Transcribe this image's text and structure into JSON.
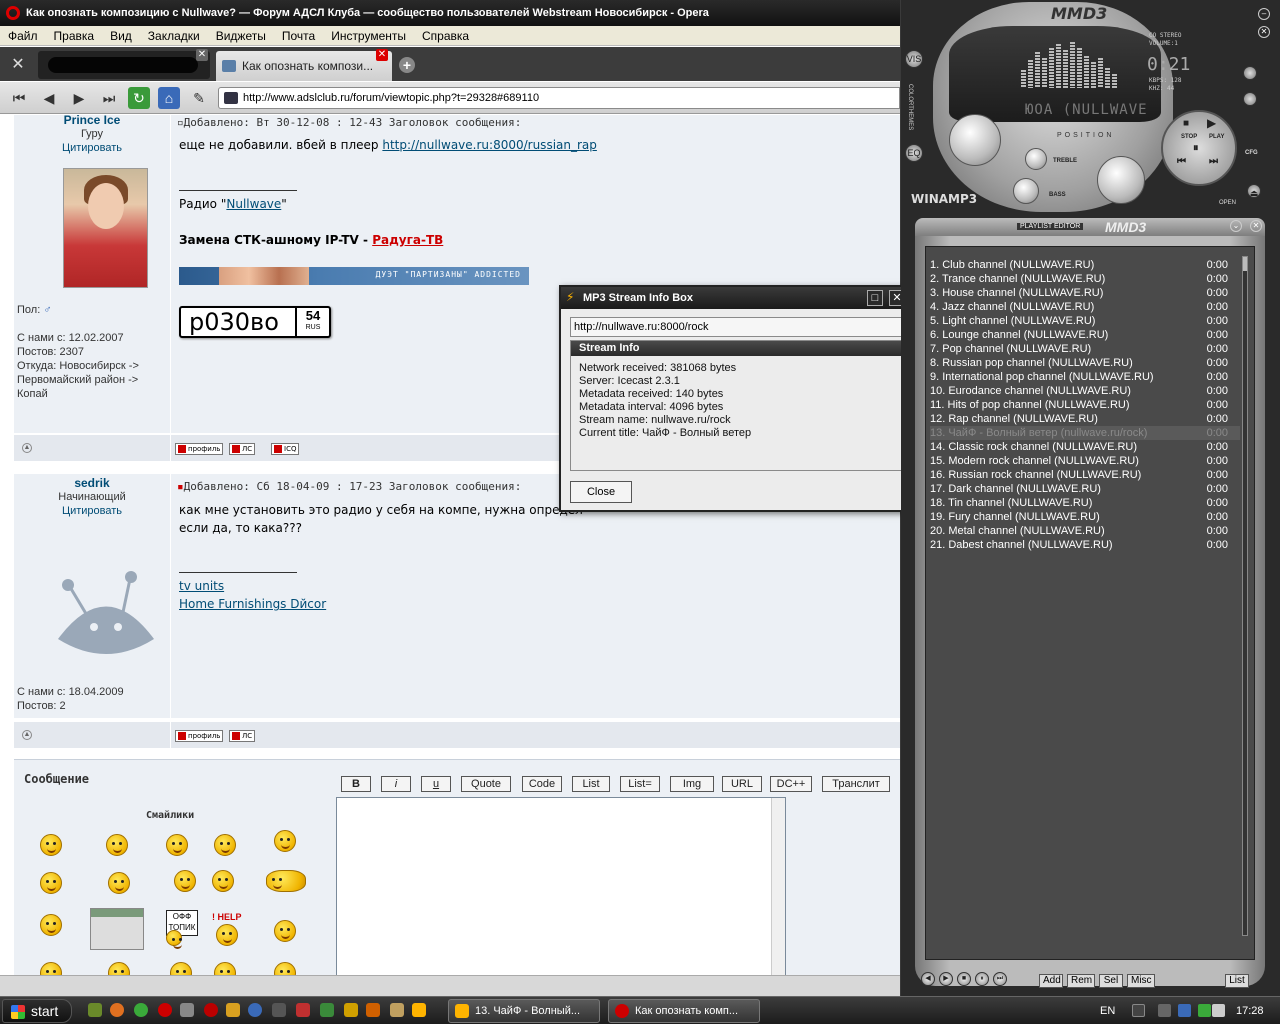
{
  "opera": {
    "title": "Как опознать композицию с Nullwave? — Форум АДСЛ Клуба — сообщество пользователей Webstream Новосибирск - Opera",
    "menu": [
      "Файл",
      "Правка",
      "Вид",
      "Закладки",
      "Виджеты",
      "Почта",
      "Инструменты",
      "Справка"
    ],
    "tab_title": "Как опознать компози...",
    "url": "http://www.adslclub.ru/forum/viewtopic.php?t=29328#689110",
    "icons": [
      "tools-icon",
      "rewind-icon",
      "back-icon",
      "forward-icon",
      "fast-forward-icon",
      "reload-icon",
      "home-icon",
      "wand-icon"
    ]
  },
  "post1": {
    "author": "Prince Ice",
    "rank": "Гуру",
    "quote": "Цитировать",
    "gender_label": "Пол:",
    "joined": "С нами с: 12.02.2007",
    "posts": "Постов: 2307",
    "from1": "Откуда: Новосибирск ->",
    "from2": "Первомайский район ->",
    "from3": "Копай",
    "header": "Добавлено: Вт 30-12-08 : 12-43    Заголовок сообщения:",
    "text": "еще не добавили. вбей в плеер",
    "link": "http://nullwave.ru:8000/russian_rap",
    "radio_prefix": "Радио \"",
    "radio_link": "Nullwave",
    "radio_suffix": "\"",
    "sig_text": "Замена СТК-ашному IP-TV - ",
    "sig_link": "Радуга-ТВ",
    "banner_text": "ДУЭТ \"ПАРТИЗАНЫ\" ADDICTED",
    "plate_number": "р030во",
    "plate_region": "54",
    "plate_rus": "RUS",
    "btn_profile": "профиль",
    "btn_pm": "ЛС",
    "btn_icq": "ICQ"
  },
  "post2": {
    "author": "sedrik",
    "rank": "Начинающий",
    "quote": "Цитировать",
    "joined": "С нами с: 18.04.2009",
    "posts": "Постов: 2",
    "header": "Добавлено: Сб 18-04-09 : 17-23    Заголовок сообщения:",
    "text1": "как мне установить это радио у себя на компе, нужна определ",
    "text2": "если да, то кака???",
    "link1": "tv units",
    "link2": "Home Furnishings Dйcor",
    "btn_profile": "профиль",
    "btn_pm": "ЛС"
  },
  "reply": {
    "title": "Сообщение",
    "smilies_title": "Смайлики",
    "buttons": [
      "B",
      "i",
      "u",
      "Quote",
      "Code",
      "List",
      "List=",
      "Img",
      "URL",
      "DC++",
      "Транслит"
    ],
    "sign_text": "ОФФ ТОПИК",
    "help_text": "! HELP"
  },
  "dialog": {
    "title": "MP3 Stream Info Box",
    "url": "http://nullwave.ru:8000/rock",
    "group_title": "Stream Info",
    "lines": [
      "Network received: 381068 bytes",
      "Server: Icecast 2.3.1",
      "Metadata received: 140 bytes",
      "Metadata interval: 4096 bytes",
      "Stream name: nullwave.ru/rock",
      "Current title: ЧайФ - Волный ветер"
    ],
    "close_label": "Close"
  },
  "player": {
    "logo": "MMD3",
    "time": "0:21",
    "stereo": "CO STEREO",
    "volume": "VOLUME:1",
    "kbps": "KBPS: 128",
    "khz": "KHZ: 44",
    "scroll_text": "ЮОА  (NULLWAVE",
    "position_label": "POSITION",
    "stop_label": "STOP",
    "play_label": "PLAY",
    "treble_label": "TREBLE",
    "bass_label": "BASS",
    "winamp_logo": "WINAMP3",
    "open_label": "OPEN",
    "colorthemes": "COLORTHEMES",
    "vis_label": "VIS",
    "eq_label": "EQ",
    "cfg_label": "CFG"
  },
  "playlist": {
    "editor_label": "PLAYLIST EDITOR",
    "logo": "MMD3",
    "items": [
      {
        "title": "1. Club channel (NULLWAVE.RU)",
        "duration": "0:00"
      },
      {
        "title": "2. Trance channel (NULLWAVE.RU)",
        "duration": "0:00"
      },
      {
        "title": "3. House channel (NULLWAVE.RU)",
        "duration": "0:00"
      },
      {
        "title": "4. Jazz channel (NULLWAVE.RU)",
        "duration": "0:00"
      },
      {
        "title": "5. Light channel (NULLWAVE.RU)",
        "duration": "0:00"
      },
      {
        "title": "6. Lounge channel (NULLWAVE.RU)",
        "duration": "0:00"
      },
      {
        "title": "7. Pop channel (NULLWAVE.RU)",
        "duration": "0:00"
      },
      {
        "title": "8. Russian pop channel (NULLWAVE.RU)",
        "duration": "0:00"
      },
      {
        "title": "9. International pop channel (NULLWAVE.RU)",
        "duration": "0:00"
      },
      {
        "title": "10. Eurodance channel (NULLWAVE.RU)",
        "duration": "0:00"
      },
      {
        "title": "11. Hits of pop channel (NULLWAVE.RU)",
        "duration": "0:00"
      },
      {
        "title": "12. Rap channel (NULLWAVE.RU)",
        "duration": "0:00"
      },
      {
        "title": "13. ЧайФ - Волный ветер (nullwave.ru/rock)",
        "duration": "0:00"
      },
      {
        "title": "14. Classic rock channel (NULLWAVE.RU)",
        "duration": "0:00"
      },
      {
        "title": "15. Modern rock channel (NULLWAVE.RU)",
        "duration": "0:00"
      },
      {
        "title": "16. Russian rock channel (NULLWAVE.RU)",
        "duration": "0:00"
      },
      {
        "title": "17. Dark channel (NULLWAVE.RU)",
        "duration": "0:00"
      },
      {
        "title": "18. Tin channel (NULLWAVE.RU)",
        "duration": "0:00"
      },
      {
        "title": "19. Fury channel (NULLWAVE.RU)",
        "duration": "0:00"
      },
      {
        "title": "20. Metal channel (NULLWAVE.RU)",
        "duration": "0:00"
      },
      {
        "title": "21. Dabest channel (NULLWAVE.RU)",
        "duration": "0:00"
      }
    ],
    "current_index": 12,
    "buttons": [
      "Add",
      "Rem",
      "Sel",
      "Misc",
      "List"
    ]
  },
  "taskbar": {
    "start_label": "start",
    "task1": "13. ЧайФ - Волный...",
    "task2": "Как опознать комп...",
    "lang": "EN",
    "clock": "17:28"
  },
  "colors": {
    "forum_bg": "#ecf0f5",
    "link": "#004c75",
    "red_link": "#cc0000",
    "dark_chrome": "#2a2a2a"
  }
}
